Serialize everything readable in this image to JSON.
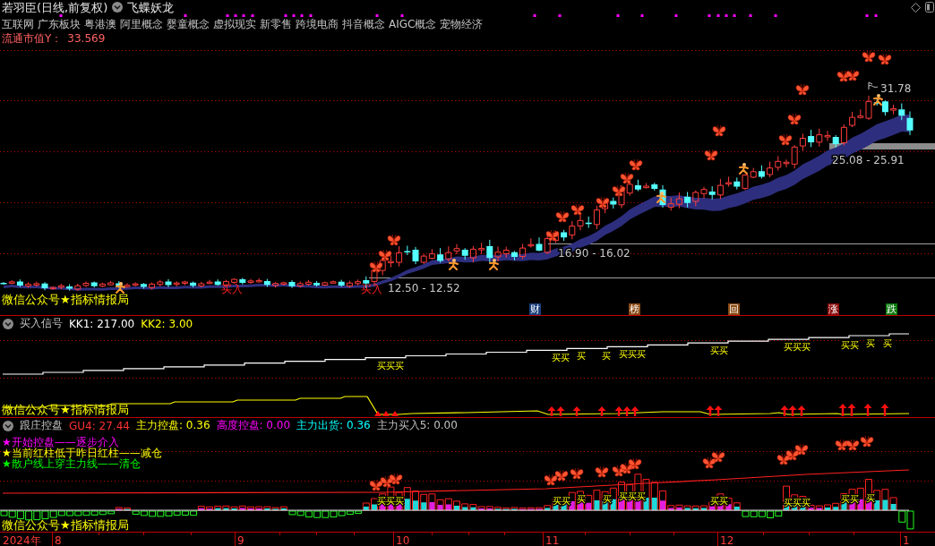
{
  "header": {
    "title": "若羽臣(日线,前复权)",
    "indicator": "飞蝶妖龙"
  },
  "concepts": [
    "互联网",
    "广东板块",
    "粤港澳",
    "阿里概念",
    "婴童概念",
    "虚拟现实",
    "新零售",
    "跨境电商",
    "抖音概念",
    "AIGC概念",
    "宠物经济"
  ],
  "market_cap": {
    "label": "流通市值Y：",
    "value": "33.569"
  },
  "main_chart": {
    "price_labels": [
      {
        "kind": "high",
        "text": "31.78"
      },
      {
        "kind": "range",
        "text": "25.08 - 25.91"
      },
      {
        "kind": "range",
        "text": "16.90 - 16.02"
      },
      {
        "kind": "range",
        "text": "12.50 - 12.52"
      }
    ],
    "signals": [
      "买入",
      "买入"
    ],
    "note": "微信公众号★指标情报局",
    "badges": [
      {
        "text": "财",
        "color": "#1c3f7c"
      },
      {
        "text": "榜",
        "color": "#8a4a14"
      },
      {
        "text": "回",
        "color": "#8a4a14"
      },
      {
        "text": "涨",
        "color": "#8b0d0d"
      },
      {
        "text": "跌",
        "color": "#0c7a0c"
      }
    ]
  },
  "buy_signal_panel": {
    "title": "买入信号",
    "values": [
      {
        "text": "KK1: 217.00",
        "color": "#ffffff"
      },
      {
        "text": "KK2: 3.00",
        "color": "#ffff00"
      }
    ],
    "signals": [
      "买买买",
      "买买",
      "买",
      "买",
      "买买买",
      "买买",
      "买买买",
      "买买",
      "买",
      "买"
    ],
    "note": "微信公众号★指标情报局"
  },
  "control_panel": {
    "title": "跟庄控盘",
    "values": [
      {
        "text": "GU4: 27.44",
        "color": "#ff3030"
      },
      {
        "text": "主力控盘: 0.36",
        "color": "#ffff00"
      },
      {
        "text": "高度控盘: 0.00",
        "color": "#ff00ff"
      },
      {
        "text": "主力出货: 0.36",
        "color": "#00ffff"
      },
      {
        "text": "主力买入5: 0.00",
        "color": "#c0c0c0"
      }
    ],
    "legend": [
      {
        "text": "★开始控盘——逐步介入",
        "color": "#ff00ff"
      },
      {
        "text": "★当前红柱低于昨日红柱——减仓",
        "color": "#ffff00"
      },
      {
        "text": "★散户线上穿主力线——清仓",
        "color": "#00ff00"
      }
    ],
    "signals": [
      "买买买",
      "买买",
      "买",
      "买",
      "买买买",
      "买买",
      "买买买",
      "买买",
      "买"
    ],
    "note": "微信公众号★指标情报局"
  },
  "x_axis": {
    "year": "2024年",
    "months": [
      "8",
      "9",
      "10",
      "11",
      "12",
      "1"
    ]
  }
}
